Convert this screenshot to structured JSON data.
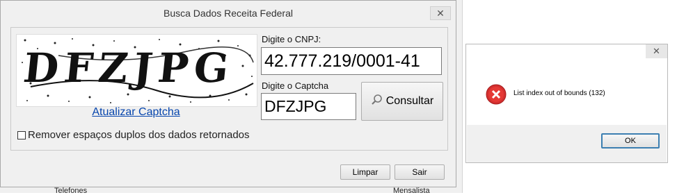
{
  "dialog": {
    "title": "Busca Dados Receita Federal",
    "close_symbol": "✕",
    "captcha_image_text": "DFZJPG",
    "refresh_captcha_label": "Atualizar Captcha",
    "cnpj_label": "Digite o CNPJ:",
    "cnpj_value": "42.777.219/0001-41",
    "captcha_label": "Digite o Captcha",
    "captcha_value": "DFZJPG",
    "consult_label": "Consultar",
    "remove_spaces_label": "Remover espaços duplos dos dados retornados",
    "remove_spaces_checked": false,
    "clear_label": "Limpar",
    "exit_label": "Sair"
  },
  "error_dialog": {
    "close_symbol": "✕",
    "icon": "error-icon",
    "message": "List index out of bounds (132)",
    "ok_label": "OK"
  },
  "background": {
    "fragment_1": "Telefones",
    "fragment_2": "Mensalista"
  }
}
